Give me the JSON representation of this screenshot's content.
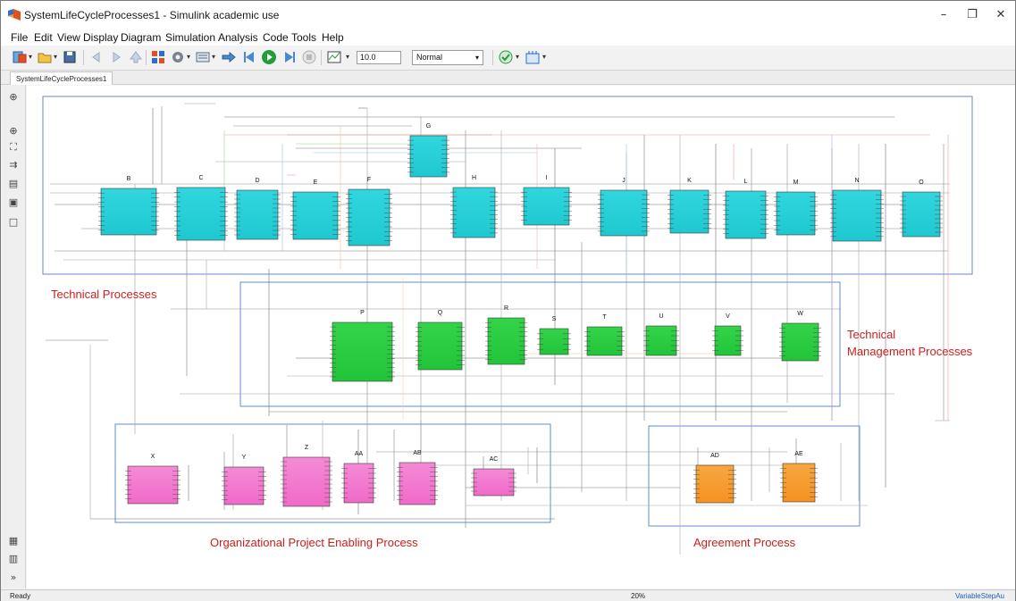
{
  "window": {
    "title": "SystemLifeCycleProcesses1 - Simulink academic use",
    "minimize_glyph": "–",
    "restore_glyph": "❐",
    "close_glyph": "✕"
  },
  "menu": [
    "File",
    "Edit",
    "View",
    "Display",
    "Diagram",
    "Simulation",
    "Analysis",
    "Code",
    "Tools",
    "Help"
  ],
  "toolbar": {
    "stop_time": "10.0",
    "simulation_mode": "Normal",
    "icons": [
      "library-browser-icon",
      "open-icon",
      "save-icon",
      "back-icon",
      "forward-icon",
      "up-icon",
      "model-explorer-icon",
      "settings-gear-icon",
      "configuration-icon",
      "update-diagram-icon",
      "step-back-icon",
      "run-icon",
      "step-forward-icon",
      "stop-icon",
      "scope-icon",
      "model-advisor-icon",
      "build-icon"
    ]
  },
  "tabs": {
    "model_tab": "SystemLifeCycleProcesses1"
  },
  "palette_icons": [
    "hide-browser-icon",
    "zoom-in-icon",
    "fit-view-icon",
    "arrow-icon",
    "annotation-icon",
    "image-icon",
    "area-icon",
    "camera-icon",
    "model-browser-icon",
    "expand-icon"
  ],
  "diagram": {
    "groups": [
      {
        "id": "technical",
        "label": "Technical Processes",
        "color": "#cc1f1a"
      },
      {
        "id": "technical-management",
        "label": "Technical\nManagement Processes",
        "color": "#cc1f1a"
      },
      {
        "id": "organizational",
        "label": "Organizational Project Enabling Process",
        "color": "#cc1f1a"
      },
      {
        "id": "agreement",
        "label": "Agreement Process",
        "color": "#cc1f1a"
      }
    ],
    "blocks": {
      "technical": [
        "B",
        "C",
        "D",
        "E",
        "F",
        "G",
        "H",
        "I",
        "J",
        "K",
        "L",
        "M",
        "N",
        "O"
      ],
      "technical_management": [
        "P",
        "Q",
        "R",
        "S",
        "T",
        "U",
        "V",
        "W"
      ],
      "organizational": [
        "X",
        "Y",
        "Z",
        "AA",
        "AB",
        "AC"
      ],
      "agreement": [
        "AD",
        "AE"
      ]
    },
    "block_colors": {
      "technical": "#1fc8d0",
      "technical_management": "#22c43a",
      "organizational": "#f06ac8",
      "agreement": "#f59222",
      "group_border": "#5b8fc9"
    }
  },
  "status": {
    "left": "Ready",
    "zoom": "20%",
    "solver": "VariableStepAu"
  }
}
